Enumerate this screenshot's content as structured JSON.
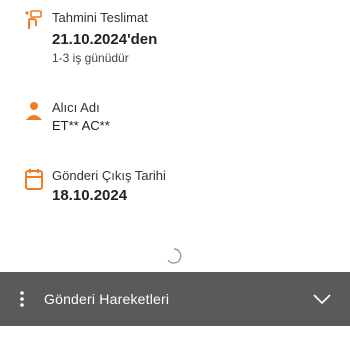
{
  "delivery": {
    "label": "Tahmini Teslimat",
    "date": "21.10.2024'den",
    "note": "1-3 iş günüdür",
    "icon": "delivery-truck-icon"
  },
  "receiver": {
    "label": "Alıcı Adı",
    "name": "ET** AC**",
    "icon": "person-icon"
  },
  "shipping": {
    "label": "Gönderi Çıkış Tarihi",
    "date": "18.10.2024",
    "icon": "calendar-icon"
  },
  "movements_bar": {
    "title": "Gönderi Hareketleri",
    "menu_icon": "vertical-dots-icon",
    "toggle_icon": "chevron-down-icon"
  },
  "colors": {
    "accent": "#f47c20",
    "bar_bg": "#5a5a5a"
  }
}
